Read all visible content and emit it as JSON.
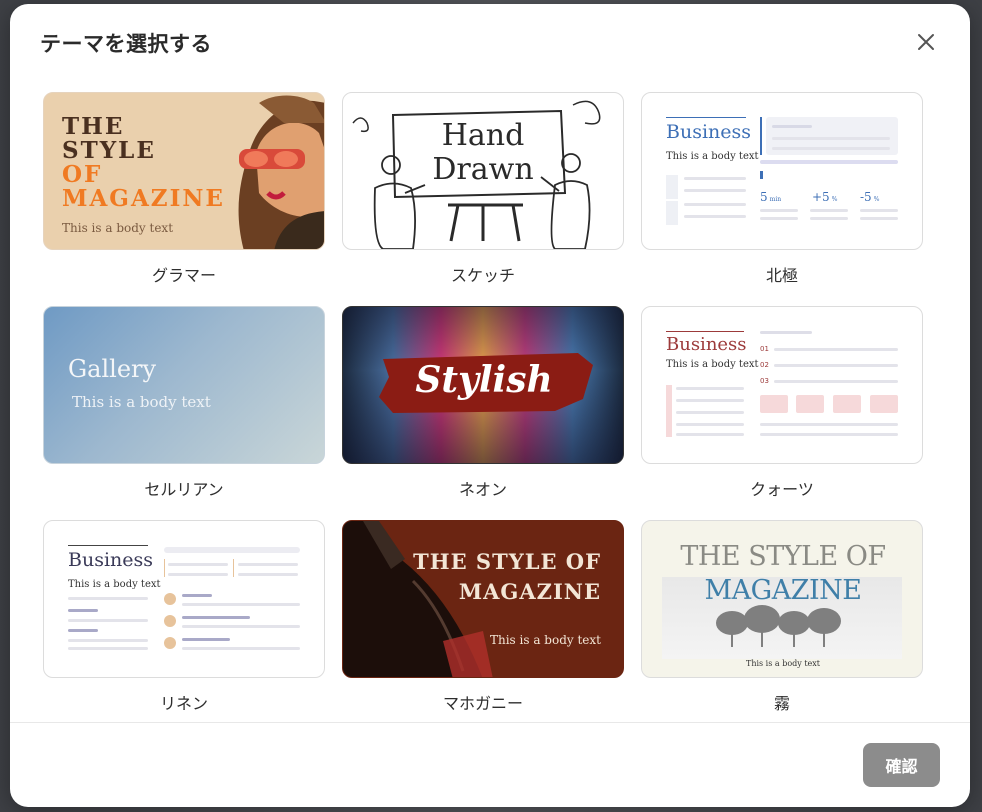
{
  "dialog": {
    "title": "テーマを選択する",
    "close_icon": "close-icon",
    "confirm_label": "確認"
  },
  "themes": [
    {
      "label": "グラマー",
      "thumb_lines": [
        "THE",
        "STYLE",
        "OF",
        "MAGAZINE"
      ],
      "body_text": "This is a body text",
      "colors": {
        "bg": "#e9cba5",
        "title": "#4a3020",
        "accent": "#f07a22"
      }
    },
    {
      "label": "スケッチ",
      "thumb_lines": [
        "Hand",
        "Drawn"
      ],
      "colors": {
        "bg": "#ffffff",
        "ink": "#2a2a2a"
      }
    },
    {
      "label": "北極",
      "thumb_title": "Business",
      "body_text": "This is a body text",
      "stats": [
        "5",
        "+5",
        "-5"
      ],
      "stat_units": [
        "min",
        "%",
        "%"
      ],
      "colors": {
        "accent": "#3d6fb6"
      }
    },
    {
      "label": "セルリアン",
      "thumb_title": "Gallery",
      "body_text": "This is a body text",
      "colors": {
        "bg_start": "#6f9ac4",
        "bg_end": "#c9d6d8"
      }
    },
    {
      "label": "ネオン",
      "thumb_title": "Stylish",
      "colors": {
        "stroke": "#8b1c14"
      }
    },
    {
      "label": "クォーツ",
      "thumb_title": "Business",
      "body_text": "This is a body text",
      "list_numbers": [
        "01",
        "02",
        "03"
      ],
      "colors": {
        "accent": "#9c3a3a",
        "chip": "#f6d9da"
      }
    },
    {
      "label": "リネン",
      "thumb_title": "Business",
      "body_text": "This is a body text",
      "colors": {
        "accent": "#e7c39b",
        "line": "#a9a9c8"
      }
    },
    {
      "label": "マホガニー",
      "thumb_lines": [
        "THE STYLE OF",
        "MAGAZINE"
      ],
      "body_text": "This is a body text",
      "colors": {
        "bg": "#6b2512"
      }
    },
    {
      "label": "霧",
      "thumb_lines": [
        "THE STYLE OF",
        "MAGAZINE"
      ],
      "body_text": "This is a body text",
      "colors": {
        "bg": "#f5f4ea",
        "accent": "#3f7fa8"
      }
    }
  ]
}
